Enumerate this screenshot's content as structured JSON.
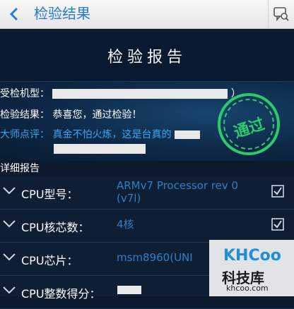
{
  "titlebar": {
    "title": "检验结果"
  },
  "banner": {
    "title": "检验报告"
  },
  "info": {
    "model_label": "受检机型：",
    "model_suffix": "）",
    "result_label": "检验结果：",
    "result_value": "恭喜您，通过检验！",
    "comment_label": "大师点评：",
    "comment_value": "真金不怕火炼，这是台真的",
    "stamp_text": "通过"
  },
  "detail": {
    "header": "详细报告",
    "items": [
      {
        "name": "CPU型号：",
        "value_line1": "ARMv7 Processor rev 0",
        "value_line2": "(v7l)"
      },
      {
        "name": "CPU核芯数：",
        "value_line1": "4核",
        "value_line2": ""
      },
      {
        "name": "CPU芯片：",
        "value_line1": "msm8960(UNI",
        "value_line2": ""
      },
      {
        "name": "CPU整数得分：",
        "value_line1": "",
        "value_line2": ""
      }
    ]
  },
  "watermark": {
    "brand": "KHCoo",
    "cn": "科技库",
    "url": "khcoo.com"
  },
  "colors": {
    "accent": "#2a7bd0",
    "stamp_green": "#2dc96a",
    "value_blue": "#3aa4f0"
  }
}
